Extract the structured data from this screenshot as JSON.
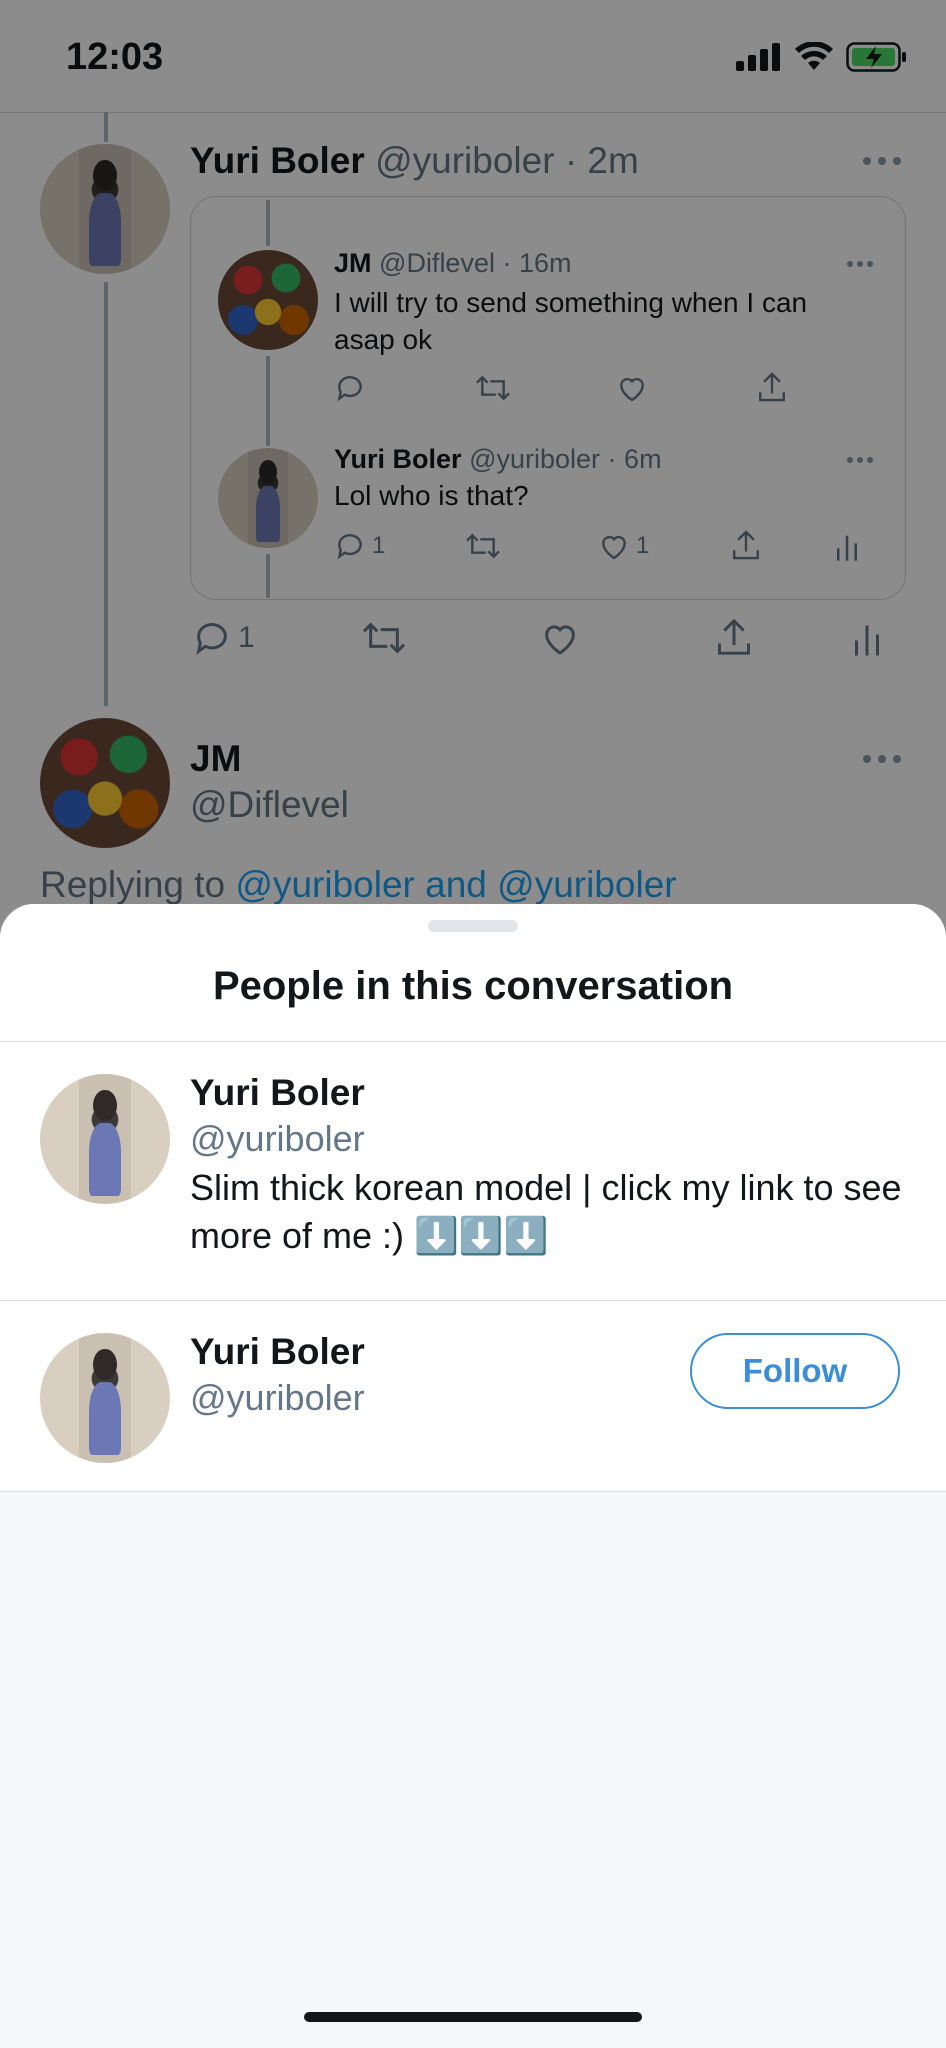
{
  "status_bar": {
    "time": "12:03"
  },
  "tweet": {
    "author_name": "Yuri Boler",
    "author_handle": "@yuriboler",
    "separator": "·",
    "time": "2m",
    "actions": {
      "reply_count": "1"
    }
  },
  "quoted_thread": [
    {
      "name": "JM",
      "handle": "@Diflevel",
      "separator": "·",
      "time": "16m",
      "text": "I will try to send something when I can asap ok"
    },
    {
      "name": "Yuri Boler",
      "handle": "@yuriboler",
      "separator": "·",
      "time": "6m",
      "text": "Lol who is that?",
      "reply_count": "1",
      "like_count": "1"
    }
  ],
  "reply_author": {
    "name": "JM",
    "handle": "@Diflevel",
    "replying_prefix": "Replying to",
    "replying_targets": "@yuriboler and @yuriboler"
  },
  "sheet": {
    "title": "People in this conversation",
    "people": [
      {
        "name": "Yuri Boler",
        "handle": "@yuriboler",
        "bio": "Slim thick korean model | click my link to see more of me :) ⬇️⬇️⬇️"
      },
      {
        "name": "Yuri Boler",
        "handle": "@yuriboler",
        "follow_label": "Follow"
      }
    ]
  },
  "colors": {
    "accent": "#3b8ed6",
    "handle_gray": "#657786",
    "text": "#14171a"
  }
}
